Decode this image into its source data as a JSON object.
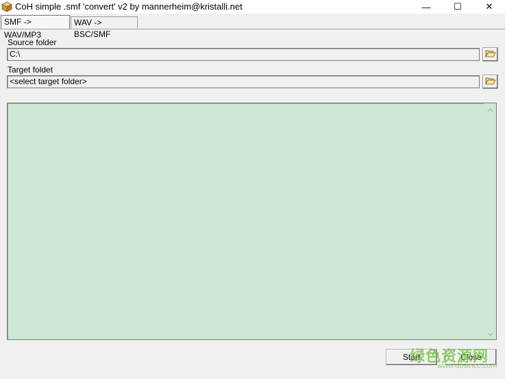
{
  "window": {
    "title": "CoH simple .smf 'convert' v2 by mannerheim@kristalli.net",
    "icon": "package-icon",
    "controls": {
      "minimize": "—",
      "maximize": "☐",
      "close": "✕"
    }
  },
  "tabs": [
    {
      "label": "SMF -> WAV/MP3",
      "active": true
    },
    {
      "label": "WAV -> BSC/SMF",
      "active": false
    }
  ],
  "source": {
    "label": "Source folder",
    "value": "C:\\"
  },
  "target": {
    "label": "Target foldet",
    "value": "<select target folder>"
  },
  "log": {
    "background": "#cde8d2"
  },
  "buttons": {
    "start": "Start",
    "close": "Close"
  },
  "watermark": {
    "main": "绿色资源网",
    "sub": "www.downcc.com"
  }
}
